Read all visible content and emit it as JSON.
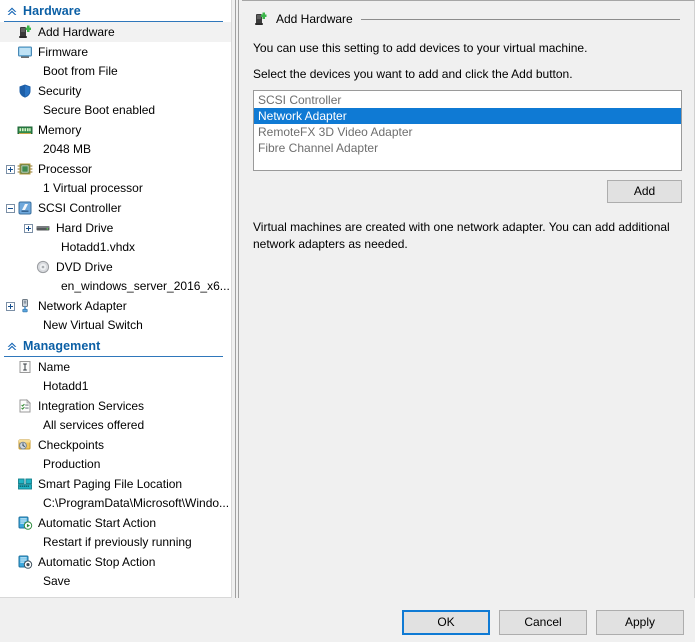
{
  "sidebar": {
    "sections": [
      {
        "id": "hardware",
        "label": "Hardware",
        "chevron_icon": "chevron-up-icon",
        "items": [
          {
            "label": "Add Hardware",
            "sub": "",
            "icon": "add-hardware-icon",
            "expander": "none",
            "selected": true,
            "indent": 0
          },
          {
            "label": "Firmware",
            "sub": "Boot from File",
            "icon": "firmware-monitor-icon",
            "expander": "none",
            "selected": false,
            "indent": 0
          },
          {
            "label": "Security",
            "sub": "Secure Boot enabled",
            "icon": "security-shield-icon",
            "expander": "none",
            "selected": false,
            "indent": 0
          },
          {
            "label": "Memory",
            "sub": "2048 MB",
            "icon": "memory-dimm-icon",
            "expander": "none",
            "selected": false,
            "indent": 0
          },
          {
            "label": "Processor",
            "sub": "1 Virtual processor",
            "icon": "processor-chip-icon",
            "expander": "plus",
            "selected": false,
            "indent": 0
          },
          {
            "label": "SCSI Controller",
            "sub": "",
            "icon": "scsi-controller-icon",
            "expander": "minus",
            "selected": false,
            "indent": 0
          },
          {
            "label": "Hard Drive",
            "sub": "Hotadd1.vhdx",
            "icon": "hard-drive-icon",
            "expander": "plus",
            "selected": false,
            "indent": 1
          },
          {
            "label": "DVD Drive",
            "sub": "en_windows_server_2016_x6...",
            "icon": "dvd-drive-icon",
            "expander": "none",
            "selected": false,
            "indent": 1
          },
          {
            "label": "Network Adapter",
            "sub": "New Virtual Switch",
            "icon": "network-adapter-icon",
            "expander": "plus",
            "selected": false,
            "indent": 0
          }
        ]
      },
      {
        "id": "management",
        "label": "Management",
        "chevron_icon": "chevron-up-icon",
        "items": [
          {
            "label": "Name",
            "sub": "Hotadd1",
            "icon": "name-textfield-icon",
            "expander": "none",
            "selected": false,
            "indent": 0
          },
          {
            "label": "Integration Services",
            "sub": "All services offered",
            "icon": "integration-services-icon",
            "expander": "none",
            "selected": false,
            "indent": 0
          },
          {
            "label": "Checkpoints",
            "sub": "Production",
            "icon": "checkpoints-icon",
            "expander": "none",
            "selected": false,
            "indent": 0
          },
          {
            "label": "Smart Paging File Location",
            "sub": "C:\\ProgramData\\Microsoft\\Windo...",
            "icon": "smart-paging-icon",
            "expander": "none",
            "selected": false,
            "indent": 0
          },
          {
            "label": "Automatic Start Action",
            "sub": "Restart if previously running",
            "icon": "auto-start-icon",
            "expander": "none",
            "selected": false,
            "indent": 0
          },
          {
            "label": "Automatic Stop Action",
            "sub": "Save",
            "icon": "auto-stop-icon",
            "expander": "none",
            "selected": false,
            "indent": 0
          }
        ]
      }
    ]
  },
  "pane": {
    "title": "Add Hardware",
    "title_icon": "add-hardware-icon",
    "intro_line1": "You can use this setting to add devices to your virtual machine.",
    "intro_line2": "Select the devices you want to add and click the Add button.",
    "device_list": [
      {
        "label": "SCSI Controller",
        "selected": false
      },
      {
        "label": "Network Adapter",
        "selected": true
      },
      {
        "label": "RemoteFX 3D Video Adapter",
        "selected": false
      },
      {
        "label": "Fibre Channel Adapter",
        "selected": false
      }
    ],
    "add_button_label": "Add",
    "hint": "Virtual machines are created with one network adapter. You can add additional network adapters as needed."
  },
  "footer": {
    "ok_label": "OK",
    "cancel_label": "Cancel",
    "apply_label": "Apply"
  },
  "colors": {
    "selection_blue": "#0f7ad4",
    "section_header_blue": "#0b5fa5",
    "section_rule_blue": "#2f77bb",
    "window_bg": "#f0f0f0",
    "list_bg": "#ffffff",
    "disabled_text": "#6e6e6e"
  }
}
